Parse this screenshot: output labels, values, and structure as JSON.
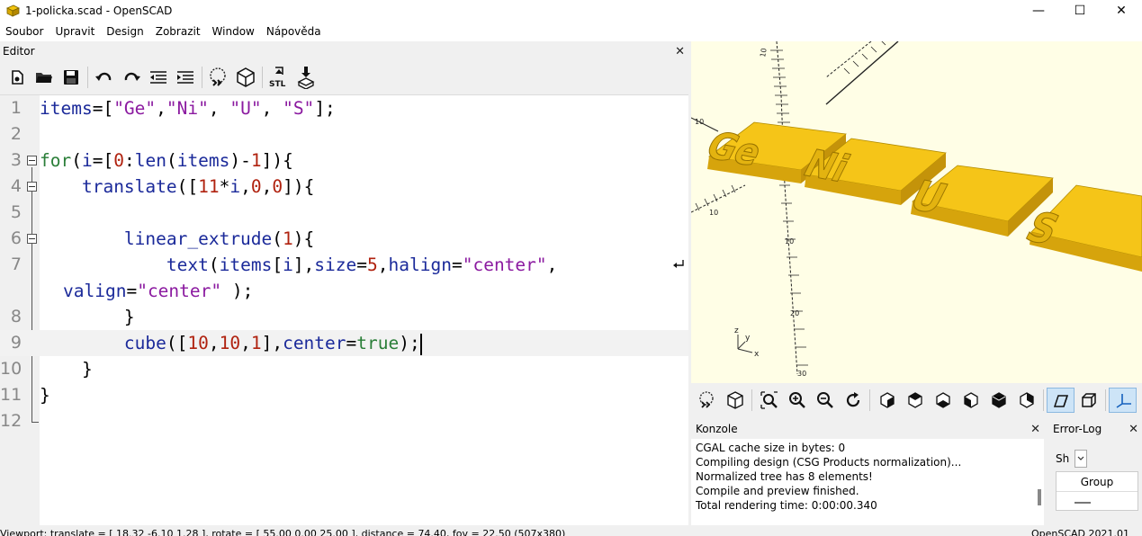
{
  "window": {
    "title": "1-policka.scad - OpenSCAD",
    "minimize": "—",
    "maximize": "☐",
    "close": "✕"
  },
  "menu": [
    "Soubor",
    "Upravit",
    "Design",
    "Zobrazit",
    "Window",
    "Nápověda"
  ],
  "editor": {
    "panel_title": "Editor",
    "panel_close": "✕",
    "toolbar": [
      "new-file-icon",
      "open-file-icon",
      "save-icon",
      "undo-icon",
      "redo-icon",
      "unindent-icon",
      "indent-icon",
      "preview-icon",
      "render-icon",
      "export-stl-icon",
      "send-to-print-icon"
    ],
    "lines": [
      {
        "num": "1",
        "text": "items=[\"Ge\",\"Ni\", \"U\", \"S\"];"
      },
      {
        "num": "2",
        "text": ""
      },
      {
        "num": "3",
        "text": "for(i=[0:len(items)-1]){"
      },
      {
        "num": "4",
        "text": "    translate([11*i,0,0]){"
      },
      {
        "num": "5",
        "text": ""
      },
      {
        "num": "6",
        "text": "        linear_extrude(1){"
      },
      {
        "num": "7",
        "text": "            text(items[i],size=5,halign=\"center\", "
      },
      {
        "num": "",
        "text": " valign=\"center\" );"
      },
      {
        "num": "8",
        "text": "        }"
      },
      {
        "num": "9",
        "text": "        cube([10,10,1],center=true);"
      },
      {
        "num": "10",
        "text": "    }"
      },
      {
        "num": "11",
        "text": "}"
      },
      {
        "num": "12",
        "text": ""
      }
    ]
  },
  "viewport": {
    "tiles": [
      "Ge",
      "Ni",
      "U",
      "S"
    ],
    "axis_labels": [
      "z",
      "y",
      "x"
    ],
    "colors": {
      "background": "#fffee6",
      "tile_top": "#f5c518",
      "tile_side": "#c99a0a"
    }
  },
  "view_toolbar": [
    "preview-icon",
    "render-icon",
    "view-all-icon",
    "zoom-in-icon",
    "zoom-out-icon",
    "reset-view-icon",
    "view-right-icon",
    "view-top-icon",
    "view-bottom-icon",
    "view-left-icon",
    "view-front-icon",
    "view-back-icon",
    "perspective-icon",
    "orthogonal-icon",
    "show-axes-icon"
  ],
  "console": {
    "title": "Konzole",
    "close": "✕",
    "lines": [
      "CGAL cache size in bytes: 0",
      "Compiling design (CSG Products normalization)...",
      "Normalized tree has 8 elements!",
      "Compile and preview finished.",
      "Total rendering time: 0:00:00.340"
    ]
  },
  "errorlog": {
    "title": "Error-Log",
    "close": "✕",
    "show_label": "Sh",
    "column": "Group"
  },
  "status": {
    "viewport": "Viewport: translate = [ 18.32 -6.10 1.28 ], rotate = [ 55.00 0.00 25.00 ], distance = 74.40, fov = 22.50 (507x380)",
    "version": "OpenSCAD 2021.01"
  }
}
